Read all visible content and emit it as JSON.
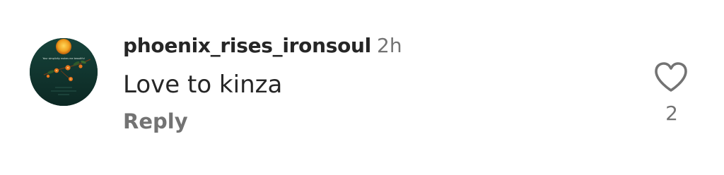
{
  "comment": {
    "username": "phoenix_rises_ironsoul",
    "timestamp": "2h",
    "text": "Love to kinza",
    "reply_label": "Reply",
    "like_count": "2",
    "avatar": {
      "icon": "avatar-sunset-flowers-image",
      "caption": "Your simplicity makes me beautiful"
    },
    "like_icon": "heart-outline-icon"
  },
  "colors": {
    "text_primary": "#262626",
    "text_secondary": "#737373",
    "background": "#ffffff",
    "avatar_bg": "#12352f",
    "sun": "#f0a020",
    "flower": "#e8761c"
  }
}
